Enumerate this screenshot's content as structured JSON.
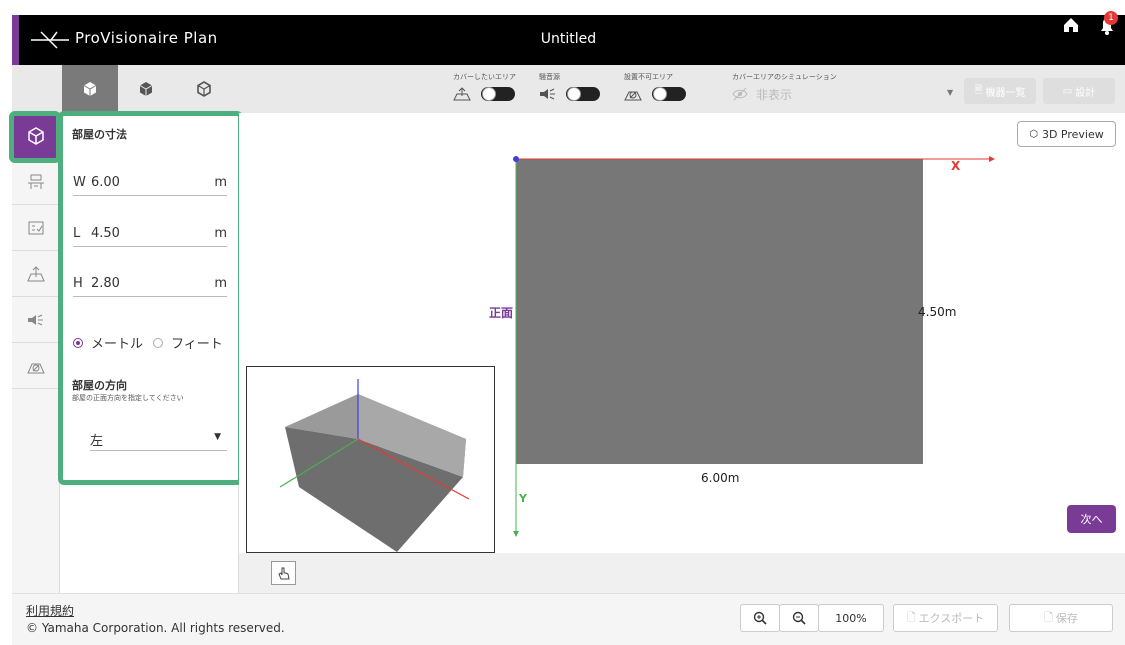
{
  "header": {
    "logo_text": "ProVisionaire Plan",
    "doc_title": "Untitled",
    "notification_count": "1"
  },
  "toolbar": {
    "cover_area_label": "カバーしたいエリア",
    "noise_label": "騒音源",
    "no_install_label": "設置不可エリア",
    "simulation_label": "カバーエリアのシミュレーション",
    "simulation_value": "非表示",
    "equipment_list_label": "機器一覧",
    "design_label": "設計"
  },
  "panel": {
    "room_dims_title": "部屋の寸法",
    "w_prefix": "W",
    "w_value": "6.00",
    "l_prefix": "L",
    "l_value": "4.50",
    "h_prefix": "H",
    "h_value": "2.80",
    "unit": "m",
    "unit_meter": "メートル",
    "unit_feet": "フィート",
    "direction_title": "部屋の方向",
    "direction_hint": "部屋の正面方向を指定してください",
    "direction_value": "左"
  },
  "canvas": {
    "preview_3d_label": "3D Preview",
    "axis_x": "X",
    "axis_y": "Y",
    "front_label": "正面",
    "length_label": "4.50m",
    "width_label": "6.00m",
    "next_label": "次へ"
  },
  "footer": {
    "terms_label": "利用規約",
    "copyright": "© Yamaha Corporation. All rights reserved.",
    "zoom_value": "100%",
    "export_label": "エクスポート",
    "save_label": "保存"
  },
  "colors": {
    "accent": "#7a3b96",
    "highlight": "#4caf7d",
    "room_fill": "#777777"
  }
}
